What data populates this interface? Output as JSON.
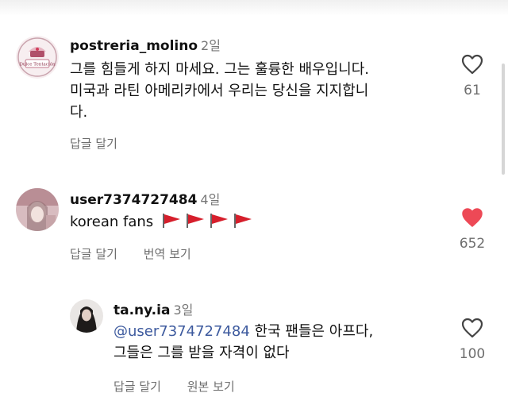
{
  "comments": [
    {
      "username": "postreria_molino",
      "time": "2일",
      "text_lines": [
        "그를 힘들게 하지 마세요. 그는 훌륭한 배우입니다.",
        "미국과 라틴 아메리카에서 우리는 당신을 지지합니",
        "다."
      ],
      "reply_label": "답글 달기",
      "like_count": "61",
      "liked": false,
      "avatar_text": "Dulce Tentación"
    },
    {
      "username": "user7374727484",
      "time": "4일",
      "text": "korean fans",
      "flag_icons": [
        "red-flag-icon",
        "red-flag-icon",
        "red-flag-icon",
        "red-flag-icon"
      ],
      "reply_label": "답글 달기",
      "translate_label": "번역 보기",
      "like_count": "652",
      "liked": true
    },
    {
      "username": "ta.ny.ia",
      "time": "3일",
      "mention": "@user7374727484",
      "text_line1": "한국 팬들은 아프다,",
      "text_line2": "그들은 그를 받을 자격이 없다",
      "reply_label": "답글 달기",
      "original_label": "원본 보기",
      "like_count": "100",
      "liked": false
    }
  ],
  "colors": {
    "heart_liked": "#ed4956",
    "mention": "#3d5a9e",
    "secondary_text": "#6e6e6e",
    "flag_red": "#d61f2c"
  }
}
